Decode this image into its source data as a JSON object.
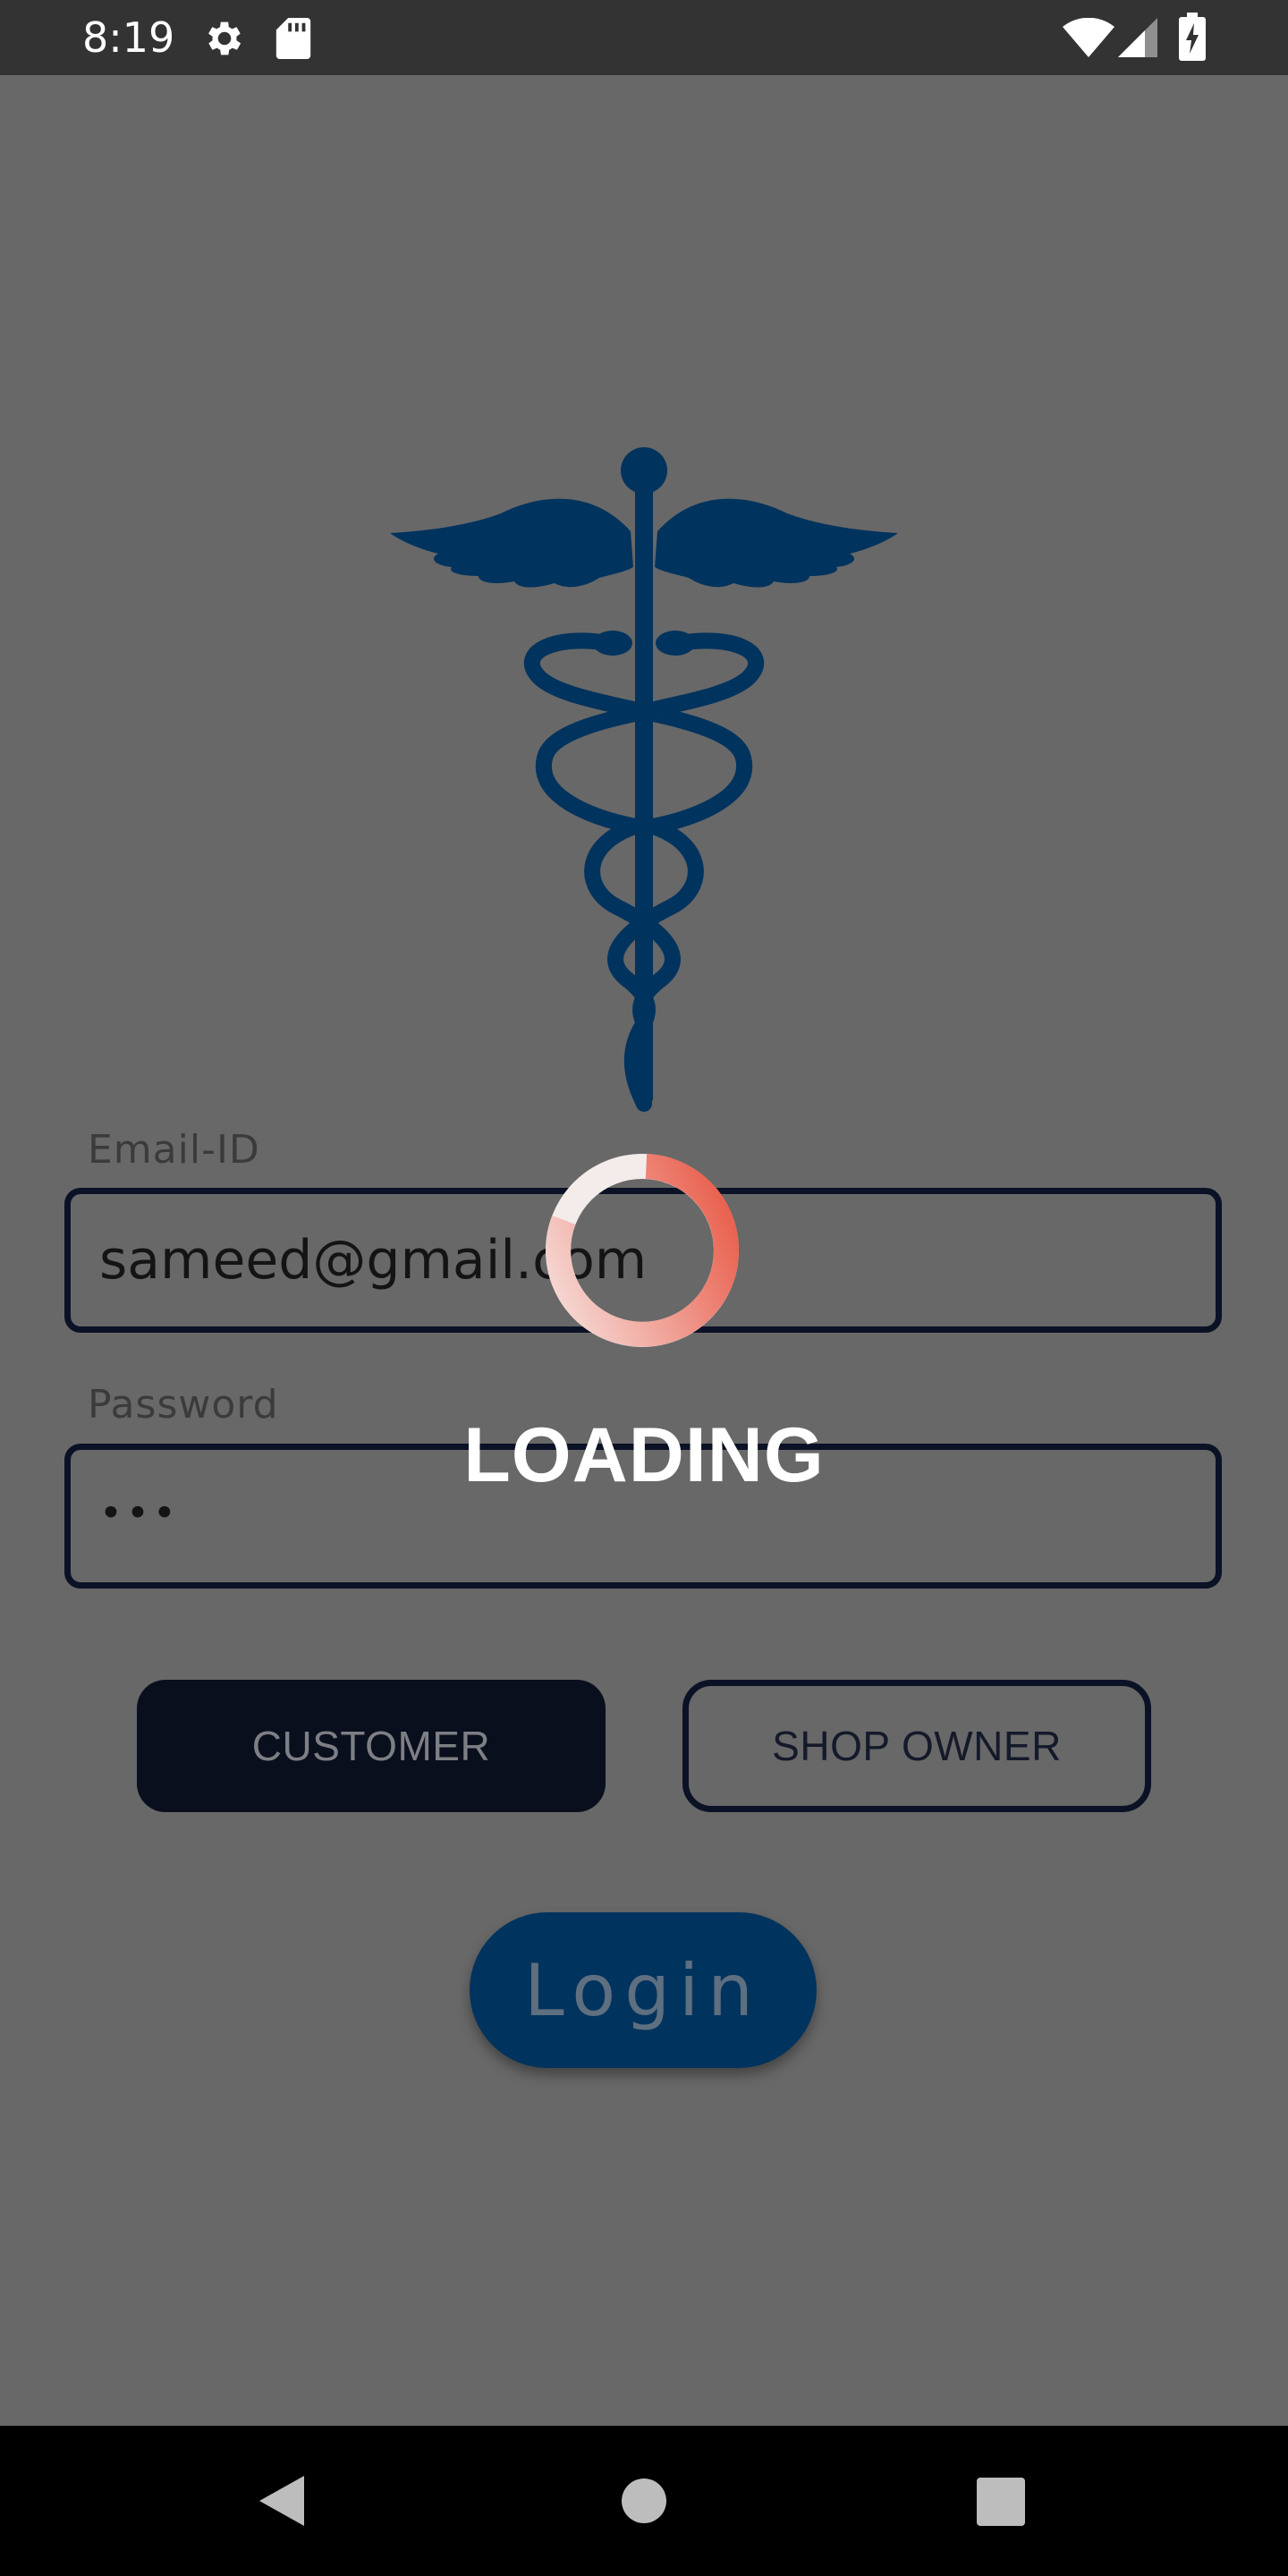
{
  "status_bar": {
    "time": "8:19",
    "icons": [
      "gear-icon",
      "sd-card-icon",
      "wifi-icon",
      "cell-signal-icon",
      "battery-charging-icon"
    ]
  },
  "login_form": {
    "email": {
      "label": "Email-ID",
      "value": "sameed@gmail.com"
    },
    "password": {
      "label": "Password",
      "value": "•••"
    },
    "roles": {
      "customer_label": "CUSTOMER",
      "shop_owner_label": "SHOP OWNER",
      "selected": "CUSTOMER"
    },
    "login_label": "Login"
  },
  "overlay": {
    "loading_text": "LOADING"
  },
  "colors": {
    "brand_navy": "#00335e",
    "dark_navy": "#0b1226",
    "spinner_accent": "#e8533f",
    "dim_overlay": "#686868"
  },
  "nav_bar": {
    "icons": [
      "back-icon",
      "home-icon",
      "recents-icon"
    ]
  }
}
